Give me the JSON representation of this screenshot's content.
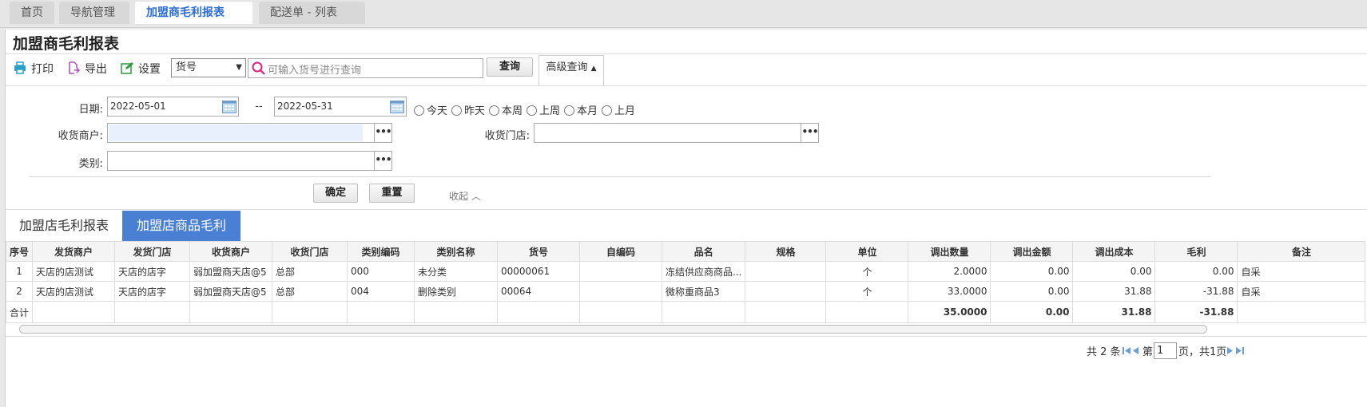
{
  "tabs": [
    {
      "label": "首页"
    },
    {
      "label": "导航管理"
    },
    {
      "label": "加盟商毛利报表",
      "close": "✕"
    },
    {
      "label": "配送单 - 列表",
      "close": "✕"
    }
  ],
  "page_title": "加盟商毛利报表",
  "toolbar": {
    "print": "打印",
    "export": "导出",
    "settings": "设置",
    "select_value": "货号",
    "search_placeholder": "可输入货号进行查询",
    "query": "查询",
    "advanced": "高级查询"
  },
  "filter": {
    "date_label": "日期:",
    "date_from": "2022-05-01",
    "date_sep": "--",
    "date_to": "2022-05-31",
    "quick": [
      "今天",
      "昨天",
      "本周",
      "上周",
      "本月",
      "上月"
    ],
    "merchant_label": "收货商户:",
    "store_label": "收货门店:",
    "category_label": "类别:",
    "confirm": "确定",
    "reset": "重置",
    "collapse": "收起"
  },
  "report_tabs": [
    "加盟店毛利报表",
    "加盟店商品毛利"
  ],
  "columns": [
    "序号",
    "发货商户",
    "发货门店",
    "收货商户",
    "收货门店",
    "类别编码",
    "类别名称",
    "货号",
    "自编码",
    "品名",
    "规格",
    "单位",
    "调出数量",
    "调出金额",
    "调出成本",
    "毛利",
    "备注"
  ],
  "rows": [
    [
      "1",
      "天店的店测试",
      "天店的店字",
      "弱加盟商天店@5",
      "总部",
      "000",
      "未分类",
      "00000061",
      "",
      "冻结供应商商品...",
      "",
      "个",
      "2.0000",
      "0.00",
      "0.00",
      "0.00",
      "自采"
    ],
    [
      "2",
      "天店的店测试",
      "天店的店字",
      "弱加盟商天店@5",
      "总部",
      "004",
      "删除类别",
      "00064",
      "",
      "微称重商品3",
      "",
      "个",
      "33.0000",
      "0.00",
      "31.88",
      "-31.88",
      "自采"
    ]
  ],
  "total_row": [
    "合计",
    "",
    "",
    "",
    "",
    "",
    "",
    "",
    "",
    "",
    "",
    "",
    "35.0000",
    "0.00",
    "31.88",
    "-31.88",
    ""
  ],
  "pager": {
    "total": "共 2 条",
    "page_prefix": "第",
    "page_value": "1",
    "page_suffix": "页，共1页"
  },
  "colors": {
    "accent": "#4a80d4",
    "tab_active_text": "#2b6cd6"
  }
}
